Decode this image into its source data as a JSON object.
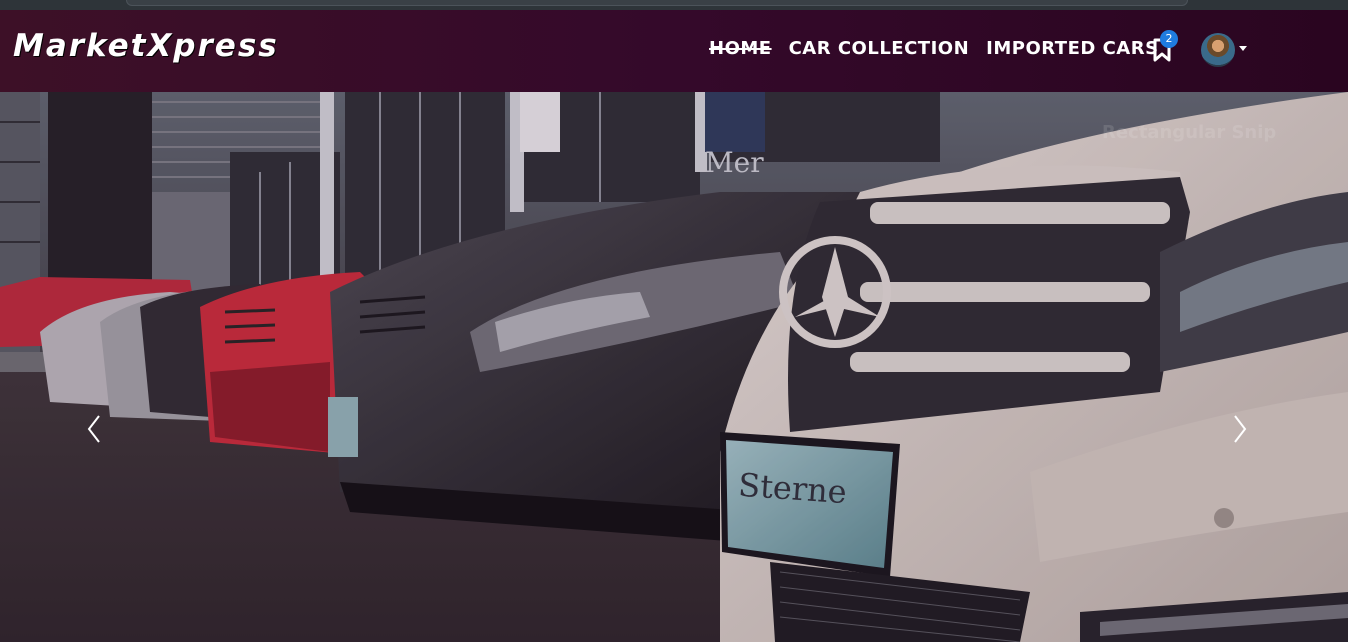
{
  "brand": {
    "name": "MarketXpress"
  },
  "nav": {
    "items": [
      {
        "label": "HOME",
        "active": true
      },
      {
        "label": "CAR COLLECTION",
        "active": false
      },
      {
        "label": "IMPORTED CARS",
        "active": false
      }
    ],
    "bookmark_icon": "bookmark-icon",
    "bookmark_count": "2",
    "avatar_icon": "avatar",
    "dropdown_icon": "caret-down-icon"
  },
  "hero": {
    "image": "row of Mercedes cars at dealership",
    "plate_text": "Sterne",
    "ghost_text": "Rectangular Snip",
    "prev_icon": "chevron-left-icon",
    "next_icon": "chevron-right-icon"
  },
  "colors": {
    "navbar": "#3d1027",
    "badge": "#1f7ce0",
    "text": "#ffffff"
  }
}
